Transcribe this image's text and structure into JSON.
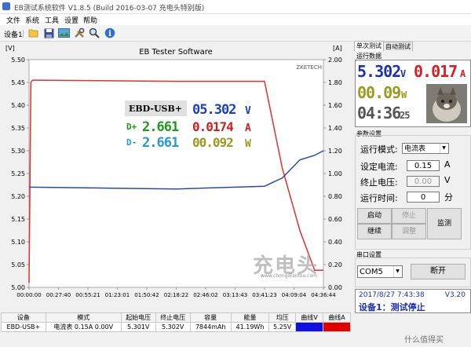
{
  "window": {
    "title": "EB测试系统软件 V1.8.5 (Build 2016-03-07 充电头特别版)"
  },
  "menu": {
    "file": "文件",
    "system": "系统",
    "tools": "工具",
    "settings": "设置",
    "help": "帮助"
  },
  "toolbar": {
    "device_label": "设备1"
  },
  "chart": {
    "title": "EB Tester Software",
    "left_unit": "[V]",
    "right_unit": "[A]",
    "brand": "ZKETECH",
    "left_ticks": [
      "5.50",
      "5.45",
      "5.40",
      "5.35",
      "5.30",
      "5.25",
      "5.20",
      "5.15",
      "5.10",
      "5.05",
      "5.00"
    ],
    "right_ticks": [
      "2.00",
      "1.80",
      "1.60",
      "1.40",
      "1.20",
      "1.00",
      "0.80",
      "0.60",
      "0.40",
      "0.20",
      "0.00"
    ],
    "x_ticks": [
      "00:00:00",
      "00:27:40",
      "00:55:21",
      "01:23:01",
      "01:50:42",
      "02:18:22",
      "02:46:02",
      "03:13:43",
      "03:41:23",
      "04:09:04",
      "04:36:44"
    ]
  },
  "chart_data": {
    "type": "line",
    "title": "EB Tester Software",
    "x_ticks": [
      "00:00:00",
      "00:27:40",
      "00:55:21",
      "01:23:01",
      "01:50:42",
      "02:18:22",
      "02:46:02",
      "03:13:43",
      "03:41:23",
      "04:09:04",
      "04:36:44"
    ],
    "y_left": {
      "unit": "V",
      "range": [
        5.0,
        5.5
      ]
    },
    "y_right": {
      "unit": "A",
      "range": [
        0.0,
        2.0
      ]
    },
    "grid": false,
    "series": [
      {
        "color": "#e03030",
        "axis": "right",
        "x_fraction": [
          0.0,
          0.006,
          0.012,
          0.02,
          0.5,
          0.8,
          0.86,
          0.92,
          0.97,
          1.0
        ],
        "values": [
          0.04,
          1.8,
          1.82,
          1.82,
          1.81,
          1.81,
          1.05,
          0.5,
          0.15,
          0.15
        ]
      },
      {
        "color": "#2a4aa8",
        "axis": "left",
        "x_fraction": [
          0.0,
          0.5,
          0.8,
          0.86,
          0.92,
          0.97,
          1.0
        ],
        "values": [
          5.22,
          5.216,
          5.222,
          5.24,
          5.28,
          5.29,
          5.3
        ]
      }
    ]
  },
  "overlay": {
    "device": "EBD-USB+",
    "voltage": "05.302",
    "dplus": "2.661",
    "dplus_current": "0.0174",
    "dminus": "2.661",
    "energy": "00.092"
  },
  "tabs": [
    "单次测试",
    "自动测试"
  ],
  "run_data": {
    "label": "运行数据",
    "voltage": "5.302",
    "v_unit": "V",
    "current": "0.017",
    "a_unit": "A",
    "power": "00.09",
    "w_unit": "W",
    "time": "04:36",
    "seconds": "25"
  },
  "params": {
    "label": "参数设置",
    "mode_label": "运行模式:",
    "mode_value": "电流表",
    "current_label": "设定电流:",
    "current_value": "0.15",
    "current_unit": "A",
    "stop_label": "终止电压:",
    "stop_value": "0.00",
    "stop_unit": "V",
    "time_label": "运行时间:",
    "time_value": "0",
    "time_unit": "分",
    "start": "启动",
    "stop": "停止",
    "continue": "继续",
    "adjust": "调整",
    "monitor": "监测"
  },
  "port": {
    "label": "串口设置",
    "value": "COM5",
    "disconnect": "断开"
  },
  "status": {
    "datetime": "2017/8/27 7:43:38",
    "version": "V3.20",
    "message": "设备1：测试停止"
  },
  "watermark": {
    "text": "充电头",
    "url": "www.chongdiantou.com",
    "site": "什么值得买"
  },
  "table": {
    "headers": [
      "设备",
      "模式",
      "起始电压",
      "终止电压",
      "容量",
      "能量",
      "均压",
      "曲线V",
      "曲线A"
    ],
    "row": [
      "EBD-USB+",
      "电流表 0.15A 0.00V",
      "5.301V",
      "5.302V",
      "7844mAh",
      "41.19Wh",
      "5.25V",
      "",
      ""
    ],
    "curve_v_color": "#1010e0",
    "curve_a_color": "#e00000"
  }
}
